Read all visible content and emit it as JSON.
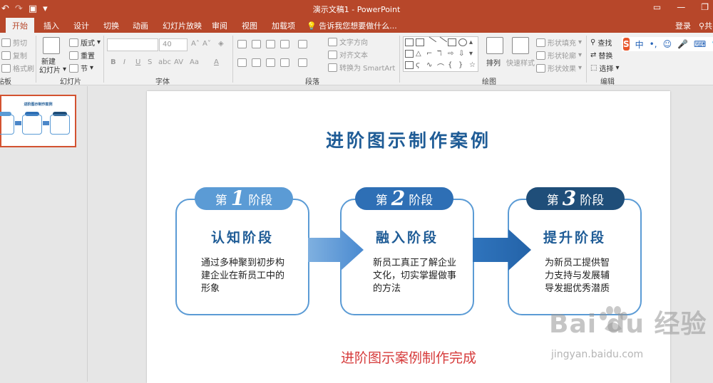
{
  "titlebar": {
    "title": "演示文稿1 - PowerPoint",
    "qat": [
      "↶",
      "↷",
      "▣",
      "▾"
    ],
    "window_buttons": [
      "▭",
      "—",
      "❐"
    ]
  },
  "tabs": {
    "items": [
      "开始",
      "插入",
      "设计",
      "切换",
      "动画",
      "幻灯片放映",
      "审阅",
      "视图",
      "加载项"
    ],
    "tell_me": "告诉我您想要做什么...",
    "login": "登录",
    "share": "共"
  },
  "ribbon": {
    "clipboard": {
      "cut": "剪切",
      "copy": "复制",
      "format_painter": "格式刷",
      "label": "剪贴板"
    },
    "slides": {
      "new_slide": "新建",
      "new_slide_2": "幻灯片",
      "layout": "版式",
      "reset": "重置",
      "section": "节",
      "label": "幻灯片"
    },
    "font": {
      "font_name": "",
      "font_size": "40",
      "label": "字体",
      "bold": "B",
      "italic": "I",
      "underline": "U",
      "strike": "S",
      "shadow": "abc",
      "spacing": "AV",
      "case": "Aa",
      "color": "A",
      "grow": "A˄",
      "shrink": "A˅",
      "clear": "◈"
    },
    "paragraph": {
      "text_direction": "文字方向",
      "align_text": "对齐文本",
      "smartart": "转换为 SmartArt",
      "label": "段落"
    },
    "drawing": {
      "arrange": "排列",
      "quick_styles": "快速样式",
      "fill": "形状填充",
      "outline": "形状轮廓",
      "effects": "形状效果",
      "label": "绘图"
    },
    "editing": {
      "find": "查找",
      "replace": "替换",
      "select": "选择",
      "label": "编辑"
    }
  },
  "ime": {
    "logo": "S",
    "items": [
      "中",
      "•,",
      "☺",
      "🎤",
      "⌨",
      "👕"
    ]
  },
  "thumbnail": {
    "number": "1",
    "title": "进阶图示制作案例"
  },
  "slide": {
    "title": "进阶图示制作案例",
    "stages": [
      {
        "prefix": "第",
        "number": "1",
        "suffix": "阶段",
        "name": "认知阶段",
        "desc": "通过多种聚到初步构建企业在新员工中的形象"
      },
      {
        "prefix": "第",
        "number": "2",
        "suffix": "阶段",
        "name": "融入阶段",
        "desc": "新员工真正了解企业文化，切实掌握做事的方法"
      },
      {
        "prefix": "第",
        "number": "3",
        "suffix": "阶段",
        "name": "提升阶段",
        "desc": "为新员工提供智力支持与发展辅导发掘优秀潜质"
      }
    ],
    "footer": "进阶图示案例制作完成"
  },
  "colors": {
    "stage1_tag": "#5b9bd5",
    "stage2_tag": "#2e6fb5",
    "stage3_tag": "#1f4e79",
    "title": "#1f5c96",
    "footer": "#d63b3b",
    "accent": "#b7472a"
  },
  "watermark": {
    "brand": "Bai du 经验",
    "url": "jingyan.baidu.com"
  }
}
